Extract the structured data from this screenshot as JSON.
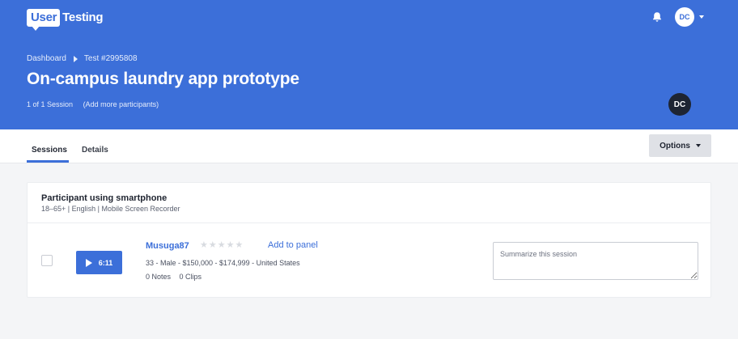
{
  "header": {
    "logo": {
      "user": "User",
      "testing": "Testing"
    },
    "user_initials": "DC",
    "breadcrumb": [
      "Dashboard",
      "Test #2995808"
    ],
    "title": "On-campus laundry app prototype",
    "session_count": "1 of 1 Session",
    "add_participants": "(Add more participants)",
    "owner_initials": "DC"
  },
  "tabs": [
    {
      "label": "Sessions",
      "active": true
    },
    {
      "label": "Details",
      "active": false
    }
  ],
  "options_label": "Options",
  "card": {
    "title": "Participant using smartphone",
    "subtitle": "18–65+ | English | Mobile Screen Recorder",
    "session": {
      "duration": "6:11",
      "username": "Musuga87",
      "rating": 0,
      "rating_max": 5,
      "add_to_panel": "Add to panel",
      "demographics": "33 - Male - $150,000 - $174,999 - United States",
      "notes": "0 Notes",
      "clips": "0 Clips",
      "summary_placeholder": "Summarize this session"
    }
  },
  "colors": {
    "brand_blue": "#3c6fd9",
    "dark_avatar": "#1e2533"
  }
}
